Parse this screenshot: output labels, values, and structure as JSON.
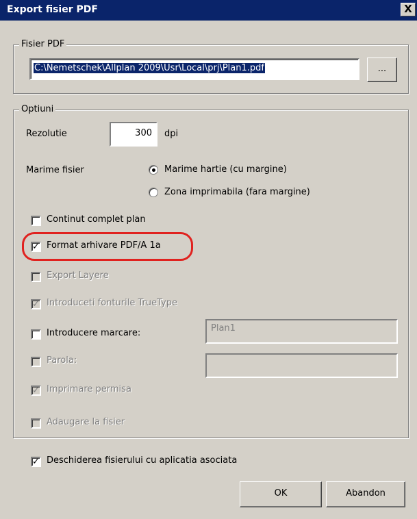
{
  "window": {
    "title": "Export fisier PDF",
    "close_label": "X"
  },
  "file_group": {
    "legend": "Fisier PDF",
    "path": "C:\\Nemetschek\\Allplan 2009\\Usr\\Local\\prj\\Plan1.pdf",
    "browse_label": "..."
  },
  "options_group": {
    "legend": "Optiuni",
    "resolution_label": "Rezolutie",
    "resolution_value": "300",
    "resolution_unit": "dpi",
    "filesize_label": "Marime fisier",
    "radio_paper": {
      "label": "Marime hartie (cu margine)",
      "checked": true
    },
    "radio_print": {
      "label": "Zona imprimabila (fara margine)",
      "checked": false
    },
    "checkboxes": [
      {
        "label": "Continut complet plan",
        "checked": false,
        "enabled": true
      },
      {
        "label": "Format arhivare PDF/A 1a",
        "checked": true,
        "enabled": true
      },
      {
        "label": "Export Layere",
        "checked": false,
        "enabled": false
      },
      {
        "label": "Introduceti fonturile TrueType",
        "checked": true,
        "enabled": false
      },
      {
        "label": "Introducere marcare:",
        "checked": false,
        "enabled": true
      },
      {
        "label": "Parola:",
        "checked": false,
        "enabled": false
      },
      {
        "label": "Imprimare permisa",
        "checked": true,
        "enabled": false
      },
      {
        "label": "Adaugare la fisier",
        "checked": false,
        "enabled": false
      }
    ],
    "marking_value": "Plan1",
    "password_value": ""
  },
  "open_with_app": {
    "label": "Deschiderea fisierului cu aplicatia asociata",
    "checked": true
  },
  "buttons": {
    "ok": "OK",
    "cancel": "Abandon"
  },
  "colors": {
    "titlebar": "#0a246a",
    "dialog_bg": "#d4d0c8",
    "highlight": "#e0221f"
  }
}
